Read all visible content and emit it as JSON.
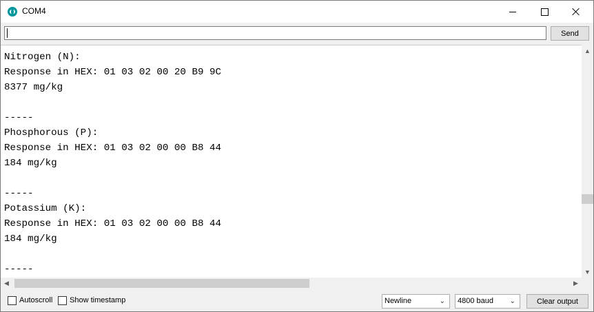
{
  "window": {
    "title": "COM4"
  },
  "input_row": {
    "value": "",
    "send_label": "Send"
  },
  "output": {
    "lines": [
      "Nitrogen (N):",
      "Response in HEX: 01 03 02 00 20 B9 9C",
      "8377 mg/kg",
      "",
      "-----",
      "Phosphorous (P):",
      "Response in HEX: 01 03 02 00 00 B8 44",
      "184 mg/kg",
      "",
      "-----",
      "Potassium (K):",
      "Response in HEX: 01 03 02 00 00 B8 44",
      "184 mg/kg",
      "",
      "-----"
    ]
  },
  "bottom": {
    "autoscroll_label": "Autoscroll",
    "autoscroll_checked": false,
    "timestamp_label": "Show timestamp",
    "timestamp_checked": false,
    "line_ending": "Newline",
    "baud": "4800 baud",
    "clear_label": "Clear output"
  },
  "icons": {
    "app": "arduino-icon",
    "minimize": "minimize-icon",
    "maximize": "maximize-icon",
    "close": "close-icon"
  },
  "colors": {
    "accent": "#00979c"
  }
}
